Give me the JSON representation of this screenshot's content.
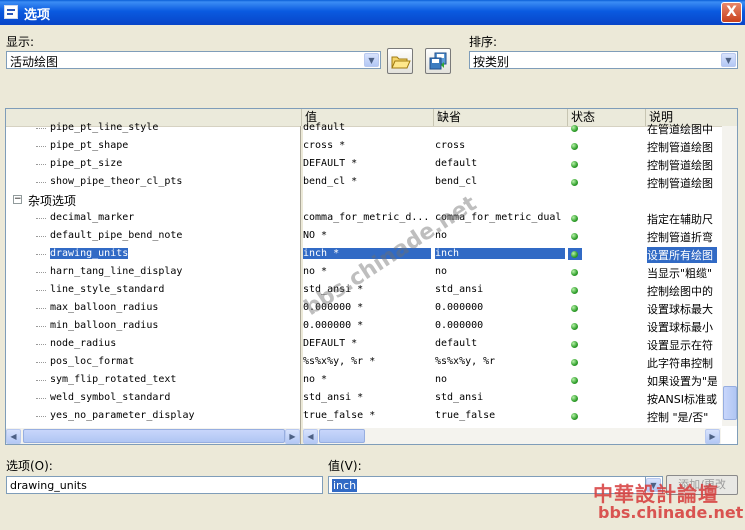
{
  "window": {
    "title": "选项",
    "close_label": "X"
  },
  "display": {
    "label": "显示:",
    "value": "活动绘图"
  },
  "sort": {
    "label": "排序:",
    "value": "按类别"
  },
  "columns": [
    "值",
    "缺省",
    "状态",
    "说明"
  ],
  "rows": [
    {
      "name": "pipe_pt_line_style",
      "value": "default",
      "default": "",
      "desc": "在管道绘图中"
    },
    {
      "name": "pipe_pt_shape",
      "value": "cross *",
      "default": "cross",
      "desc": "控制管道绘图"
    },
    {
      "name": "pipe_pt_size",
      "value": "DEFAULT *",
      "default": "default",
      "desc": "控制管道绘图"
    },
    {
      "name": "show_pipe_theor_cl_pts",
      "value": "bend_cl *",
      "default": "bend_cl",
      "desc": "控制管道绘图"
    },
    {
      "category": "杂项选项"
    },
    {
      "name": "decimal_marker",
      "value": "comma_for_metric_d...",
      "default": "comma_for_metric_dual",
      "desc": "指定在辅助尺"
    },
    {
      "name": "default_pipe_bend_note",
      "value": "NO *",
      "default": "no",
      "desc": "控制管道折弯"
    },
    {
      "name": "drawing_units",
      "value": "inch *",
      "default": "inch",
      "desc": "设置所有绘图",
      "selected": true
    },
    {
      "name": "harn_tang_line_display",
      "value": "no *",
      "default": "no",
      "desc": "当显示\"粗缆\""
    },
    {
      "name": "line_style_standard",
      "value": "std_ansi *",
      "default": "std_ansi",
      "desc": "控制绘图中的"
    },
    {
      "name": "max_balloon_radius",
      "value": "0.000000 *",
      "default": "0.000000",
      "desc": "设置球标最大"
    },
    {
      "name": "min_balloon_radius",
      "value": "0.000000 *",
      "default": "0.000000",
      "desc": "设置球标最小"
    },
    {
      "name": "node_radius",
      "value": "DEFAULT *",
      "default": "default",
      "desc": "设置显示在符"
    },
    {
      "name": "pos_loc_format",
      "value": "%s%x%y, %r *",
      "default": "%s%x%y, %r",
      "desc": "此字符串控制"
    },
    {
      "name": "sym_flip_rotated_text",
      "value": "no *",
      "default": "no",
      "desc": "如果设置为\"是"
    },
    {
      "name": "weld_symbol_standard",
      "value": "std_ansi *",
      "default": "std_ansi",
      "desc": "按ANSI标准或"
    },
    {
      "name": "yes_no_parameter_display",
      "value": "true_false *",
      "default": "true_false",
      "desc": "控制 \"是/否\""
    }
  ],
  "option_field": {
    "label": "选项(O):",
    "value": "drawing_units"
  },
  "value_field": {
    "label": "值(V):",
    "value": "inch"
  },
  "add_change_button": "添加/更改",
  "watermark": {
    "text": "bbs.chinade.net",
    "logo": "中華設計論壇"
  }
}
